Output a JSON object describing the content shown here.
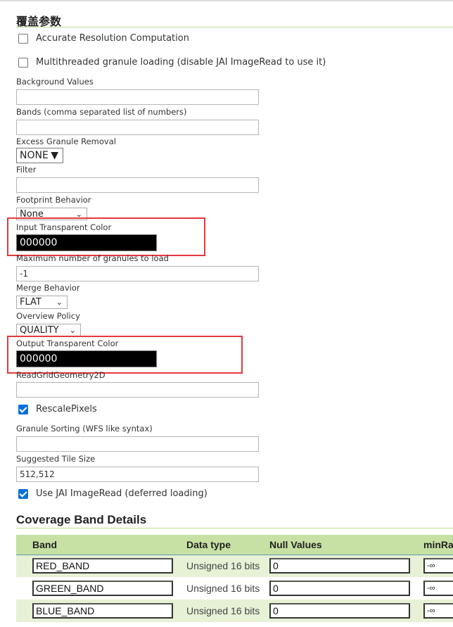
{
  "section_title": "覆盖参数",
  "checkboxes": {
    "accurate": {
      "label": "Accurate Resolution Computation",
      "checked": false
    },
    "multithreaded": {
      "label": "Multithreaded granule loading (disable JAI ImageRead to use it)",
      "checked": false
    },
    "rescale": {
      "label": "RescalePixels",
      "checked": true
    },
    "jai": {
      "label": "Use JAI ImageRead (deferred loading)",
      "checked": true
    }
  },
  "fields": {
    "background": {
      "label": "Background Values",
      "value": ""
    },
    "bands": {
      "label": "Bands (comma separated list of numbers)",
      "value": ""
    },
    "excess": {
      "label": "Excess Granule Removal",
      "value": "NONE"
    },
    "filter": {
      "label": "Filter",
      "value": ""
    },
    "footprint": {
      "label": "Footprint Behavior",
      "value": "None"
    },
    "input_color": {
      "label": "Input Transparent Color",
      "value": "000000"
    },
    "max_granules": {
      "label": "Maximum number of granules to load",
      "value": "-1"
    },
    "merge": {
      "label": "Merge Behavior",
      "value": "FLAT"
    },
    "overview": {
      "label": "Overview Policy",
      "value": "QUALITY"
    },
    "output_color": {
      "label": "Output Transparent Color",
      "value": "000000"
    },
    "readgrid": {
      "label": "ReadGridGeometry2D",
      "value": ""
    },
    "sorting": {
      "label": "Granule Sorting (WFS like syntax)",
      "value": ""
    },
    "tile": {
      "label": "Suggested Tile Size",
      "value": "512,512"
    }
  },
  "bands_section": {
    "title": "Coverage Band Details",
    "headers": [
      "Band",
      "Data type",
      "Null Values",
      "minRa"
    ],
    "rows": [
      {
        "band": "RED_BAND",
        "type": "Unsigned 16 bits",
        "null": "0",
        "min": "-∞"
      },
      {
        "band": "GREEN_BAND",
        "type": "Unsigned 16 bits",
        "null": "0",
        "min": "-∞"
      },
      {
        "band": "BLUE_BAND",
        "type": "Unsigned 16 bits",
        "null": "0",
        "min": "-∞"
      }
    ]
  },
  "colors": {
    "accent_rule": "#bcdc8c",
    "table_header": "#c7e1a4",
    "highlight_box": "#e8373b"
  }
}
